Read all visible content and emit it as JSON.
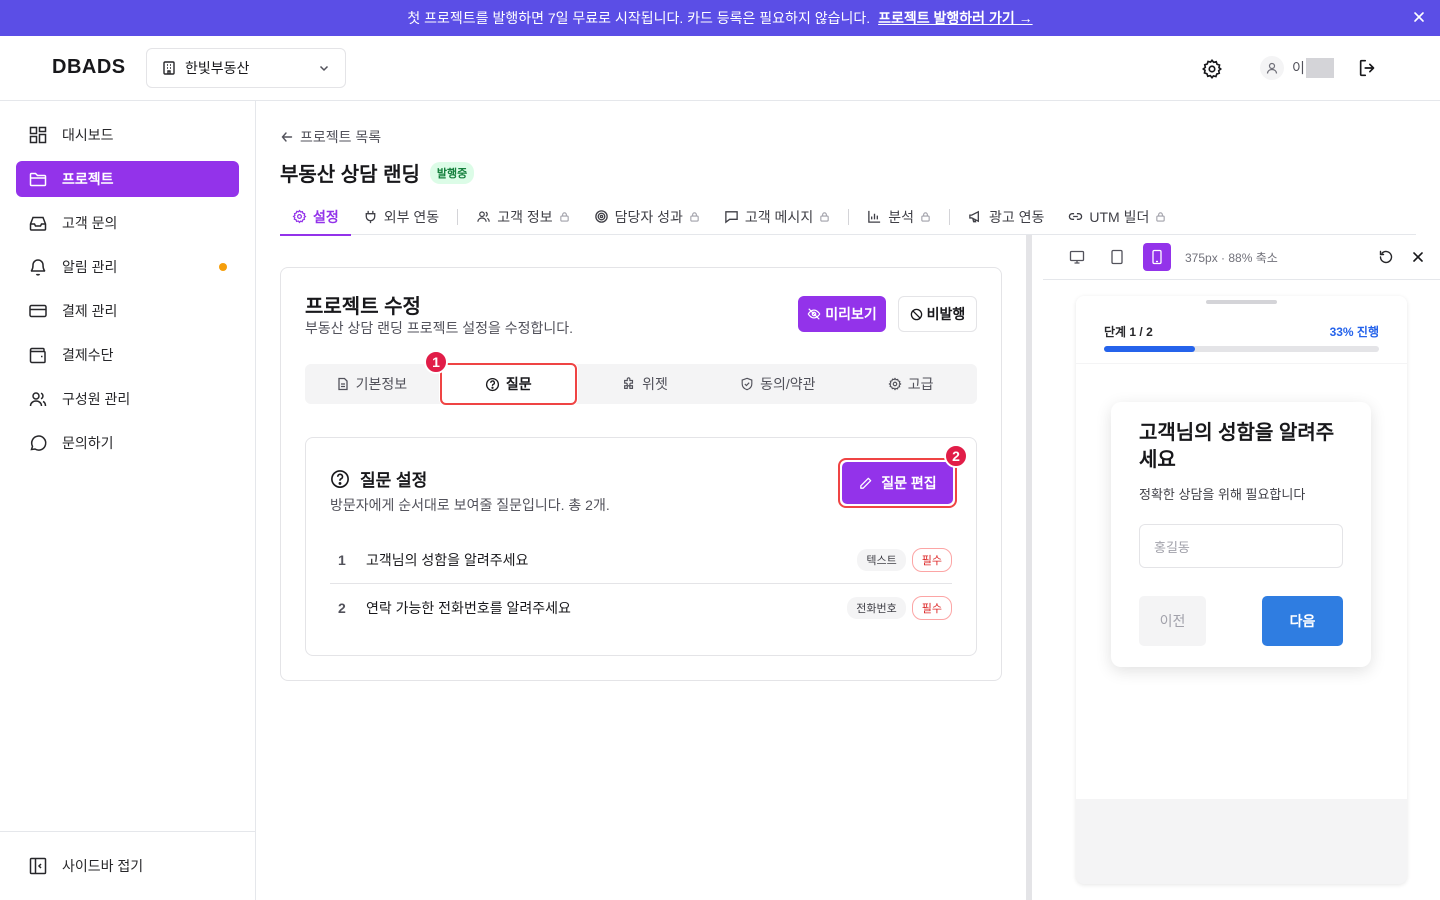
{
  "banner": {
    "text": "첫 프로젝트를 발행하면 7일 무료로 시작됩니다. 카드 등록은 필요하지 않습니다.",
    "link": "프로젝트 발행하러 가기 →"
  },
  "header": {
    "logo": "DBADS",
    "org": "한빛부동산",
    "user_initial": "이"
  },
  "sidebar": {
    "items": [
      {
        "label": "대시보드",
        "icon": "dashboard-icon"
      },
      {
        "label": "프로젝트",
        "icon": "folder-icon",
        "active": true
      },
      {
        "label": "고객 문의",
        "icon": "inbox-icon"
      },
      {
        "label": "알림 관리",
        "icon": "bell-icon",
        "dot": true
      },
      {
        "label": "결제 관리",
        "icon": "credit-card-icon"
      },
      {
        "label": "결제수단",
        "icon": "wallet-icon"
      },
      {
        "label": "구성원 관리",
        "icon": "users-icon"
      },
      {
        "label": "문의하기",
        "icon": "message-circle-icon"
      }
    ],
    "collapse_label": "사이드바 접기"
  },
  "page": {
    "back_label": "프로젝트 목록",
    "title": "부동산 상담 랜딩",
    "status": "발행중",
    "tabs": [
      {
        "label": "설정"
      },
      {
        "label": "외부 연동"
      },
      {
        "label": "고객 정보"
      },
      {
        "label": "담당자 성과"
      },
      {
        "label": "고객 메시지"
      },
      {
        "label": "분석"
      },
      {
        "label": "광고 연동"
      },
      {
        "label": "UTM 빌더"
      }
    ]
  },
  "editor": {
    "title": "프로젝트 수정",
    "subtitle": "부동산 상담 랜딩 프로젝트 설정을 수정합니다.",
    "preview_btn": "미리보기",
    "unpublish_btn": "비발행",
    "segments": [
      "기본정보",
      "질문",
      "위젯",
      "동의/약관",
      "고급"
    ],
    "marker1": "1",
    "marker2": "2",
    "section_title": "질문 설정",
    "section_desc": "방문자에게 순서대로 보여줄 질문입니다. 총 2개.",
    "edit_btn": "질문 편집",
    "questions": [
      {
        "num": "1",
        "text": "고객님의 성함을 알려주세요",
        "type": "텍스트",
        "required": "필수"
      },
      {
        "num": "2",
        "text": "연락 가능한 전화번호를 알려주세요",
        "type": "전화번호",
        "required": "필수"
      }
    ]
  },
  "preview": {
    "zoom": "375px · 88% 축소",
    "step": "단계 1 / 2",
    "progress_text": "33% 진행",
    "progress": 0.33,
    "question": "고객님의 성함을 알려주세요",
    "question_sub": "정확한 상담을 위해 필요합니다",
    "placeholder": "홍길동",
    "prev_btn": "이전",
    "next_btn": "다음"
  },
  "colors": {
    "accent": "#9333ea",
    "banner": "#5b4ee6",
    "blue": "#2563eb",
    "highlight": "#ef4444"
  }
}
